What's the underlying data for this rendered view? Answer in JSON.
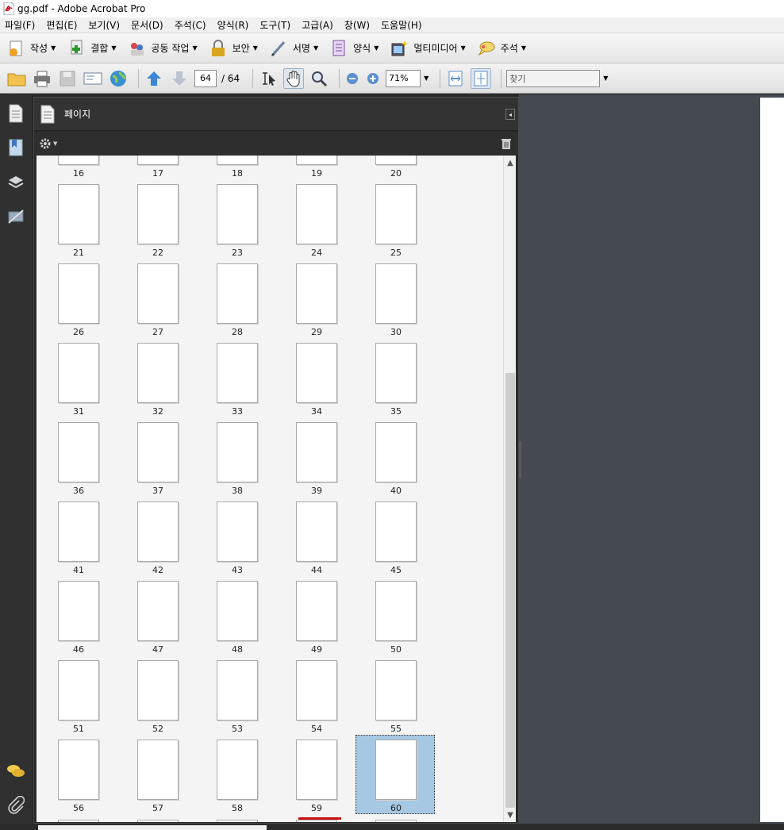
{
  "window": {
    "title": "gg.pdf - Adobe Acrobat Pro"
  },
  "menu": [
    "파일(F)",
    "편집(E)",
    "보기(V)",
    "문서(D)",
    "주석(C)",
    "양식(R)",
    "도구(T)",
    "고급(A)",
    "창(W)",
    "도움말(H)"
  ],
  "task_toolbar": [
    {
      "label": "작성",
      "icon": "create-icon"
    },
    {
      "label": "결합",
      "icon": "combine-icon"
    },
    {
      "label": "공동 작업",
      "icon": "collaborate-icon"
    },
    {
      "label": "보안",
      "icon": "lock-icon"
    },
    {
      "label": "서명",
      "icon": "pen-icon"
    },
    {
      "label": "양식",
      "icon": "form-icon"
    },
    {
      "label": "멀티미디어",
      "icon": "multimedia-icon"
    },
    {
      "label": "주석",
      "icon": "comment-icon"
    }
  ],
  "nav_toolbar": {
    "current_page": "64",
    "total_pages": "/ 64",
    "zoom": "71%",
    "find_placeholder": "찾기"
  },
  "pages_panel": {
    "title": "페이지",
    "visible_page_numbers": [
      "16",
      "17",
      "18",
      "19",
      "20",
      "21",
      "22",
      "23",
      "24",
      "25",
      "26",
      "27",
      "28",
      "29",
      "30",
      "31",
      "32",
      "33",
      "34",
      "35",
      "36",
      "37",
      "38",
      "39",
      "40",
      "41",
      "42",
      "43",
      "44",
      "45",
      "46",
      "47",
      "48",
      "49",
      "50",
      "51",
      "52",
      "53",
      "54",
      "55",
      "56",
      "57",
      "58",
      "59",
      "60"
    ],
    "selected_page": "60"
  }
}
